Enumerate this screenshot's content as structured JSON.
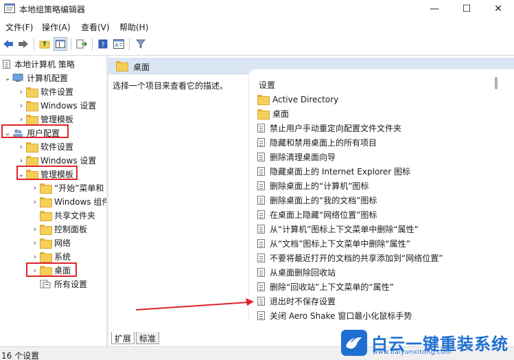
{
  "window": {
    "title": "本地组策略编辑器",
    "minimize": "—",
    "maximize": "☐",
    "close": "✕"
  },
  "menu": [
    "文件(F)",
    "操作(A)",
    "查看(V)",
    "帮助(H)"
  ],
  "tree": {
    "root": "本地计算机 策略",
    "computer_config": "计算机配置",
    "computer_children": [
      "软件设置",
      "Windows 设置",
      "管理模板"
    ],
    "user_config": "用户配置",
    "user_children": [
      "软件设置",
      "Windows 设置",
      "管理模板"
    ],
    "admin_children": [
      "“开始”菜单和",
      "Windows 组件",
      "共享文件夹",
      "控制面板",
      "网络",
      "系统",
      "桌面",
      "所有设置"
    ]
  },
  "right": {
    "header": "桌面",
    "description": "选择一个项目来查看它的描述。",
    "list_header": "设置",
    "folders": [
      "Active Directory",
      "桌面"
    ],
    "policies": [
      "禁止用户手动重定向配置文件文件夹",
      "隐藏和禁用桌面上的所有项目",
      "删除清理桌面向导",
      "隐藏桌面上的 Internet Explorer 图标",
      "删除桌面上的“计算机”图标",
      "删除桌面上的“我的文档”图标",
      "在桌面上隐藏“网络位置”图标",
      "从“计算机”图标上下文菜单中删除“属性”",
      "从“文档”图标上下文菜单中删除“属性”",
      "不要将最近打开的文档的共享添加到“网络位置”",
      "从桌面删除回收站",
      "删除“回收站”上下文菜单的“属性”",
      "退出时不保存设置",
      "关闭 Aero Shake 窗口最小化鼠标手势"
    ]
  },
  "tabs": {
    "extended": "扩展",
    "standard": "标准"
  },
  "status": "16 个设置",
  "watermark": {
    "title": "白云一键重装系统",
    "url": "www.baiyunxitong.com"
  },
  "colors": {
    "highlight_box": "#e0232b",
    "folder": "#f5cf5a",
    "header_bg": "#dbe6f4",
    "watermark": "#1f6fd1"
  }
}
